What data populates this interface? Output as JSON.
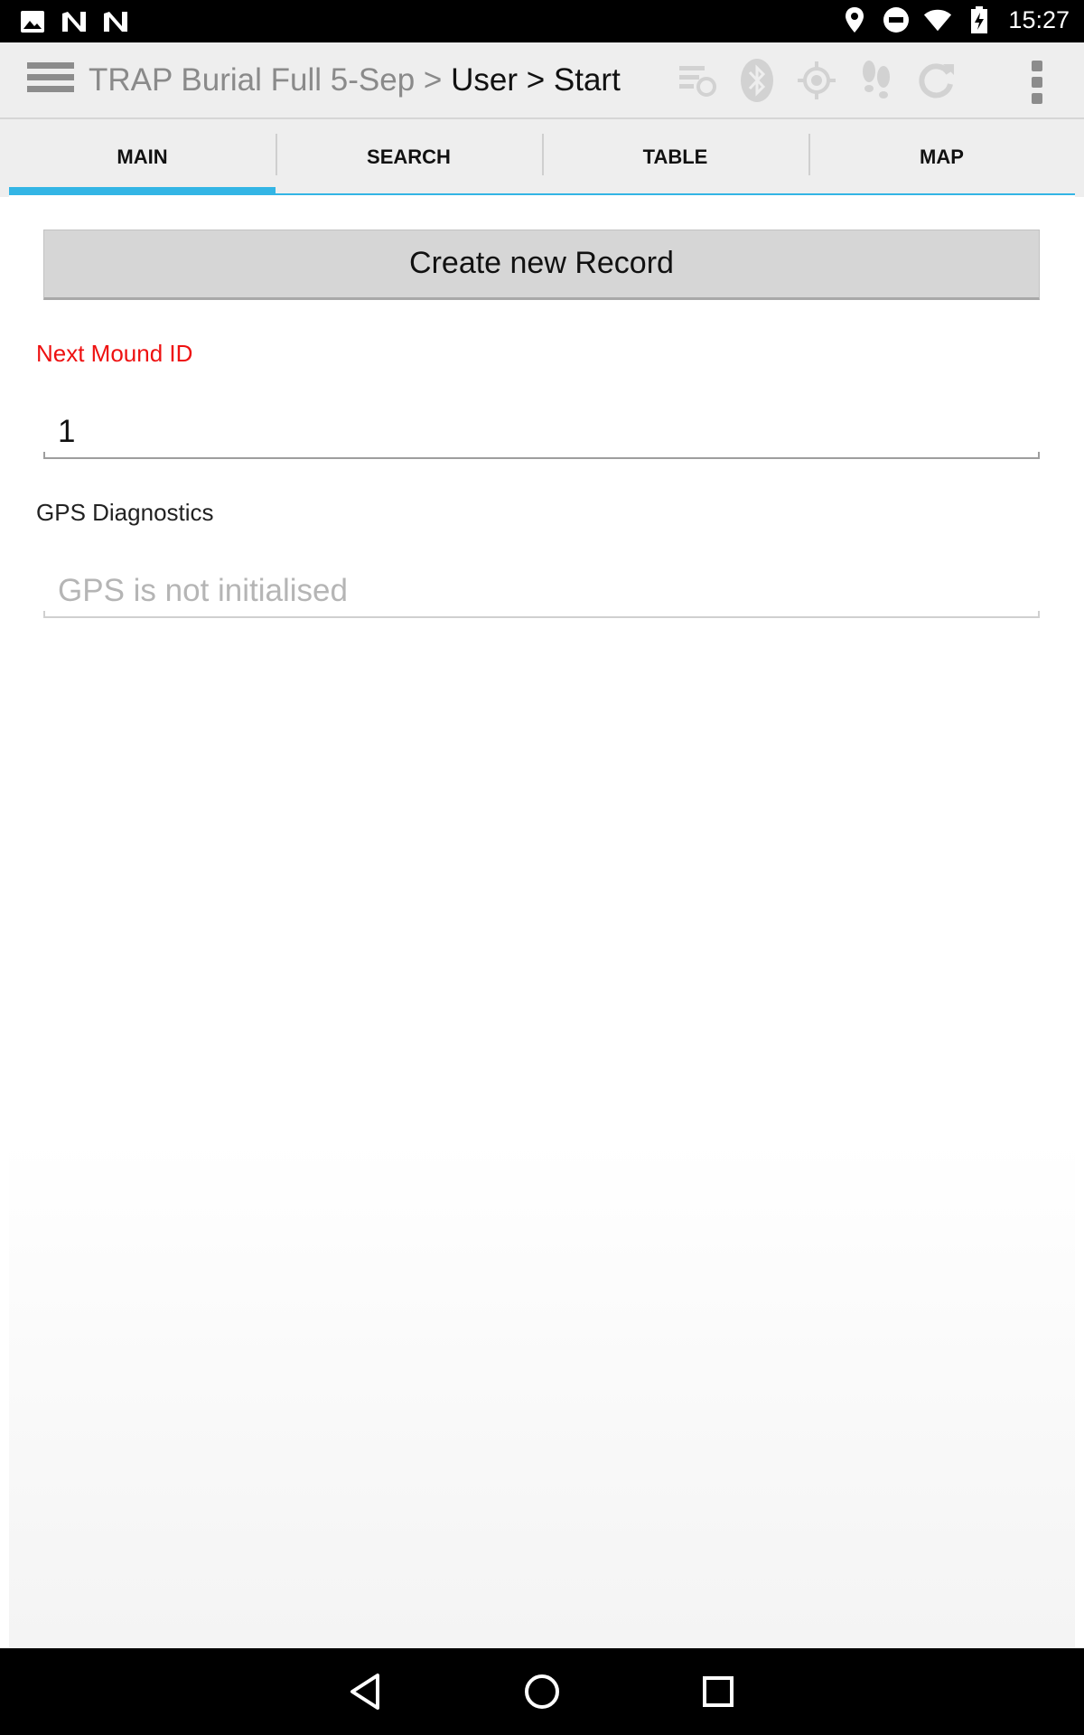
{
  "status_bar": {
    "time": "15:27",
    "left_icons": [
      "image-icon",
      "n-notification-icon",
      "n-notification-icon"
    ],
    "right_icons": [
      "location-icon",
      "do-not-disturb-icon",
      "wifi-icon",
      "battery-charging-icon"
    ]
  },
  "action_bar": {
    "project": "TRAP Burial Full 5-Sep",
    "separator": ">",
    "path": "User > Start",
    "icons": [
      "sync-list-icon",
      "bluetooth-icon",
      "gps-target-icon",
      "footsteps-icon",
      "refresh-icon"
    ]
  },
  "tabs": [
    {
      "label": "MAIN",
      "active": true
    },
    {
      "label": "SEARCH",
      "active": false
    },
    {
      "label": "TABLE",
      "active": false
    },
    {
      "label": "MAP",
      "active": false
    }
  ],
  "main": {
    "create_button_label": "Create new Record",
    "next_mound_label": "Next Mound ID",
    "next_mound_value": "1",
    "gps_label": "GPS Diagnostics",
    "gps_placeholder": "GPS is not initialised"
  },
  "colors": {
    "tab_accent": "#33b5e5",
    "required_label": "#ee1111",
    "action_bar_bg": "#eeeeee"
  }
}
